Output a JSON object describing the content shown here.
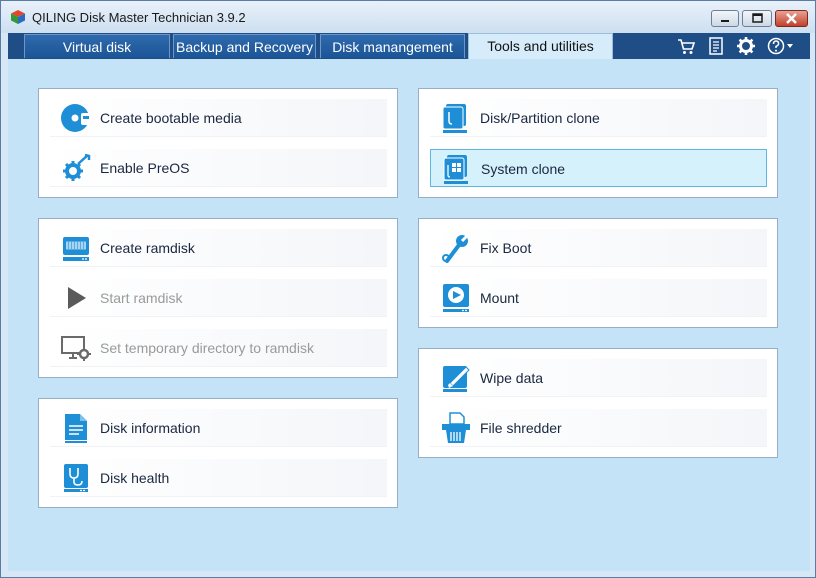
{
  "window": {
    "title": "QILING Disk Master Technician 3.9.2"
  },
  "tabs": [
    {
      "label": "Virtual disk"
    },
    {
      "label": "Backup and Recovery"
    },
    {
      "label": "Disk manangement"
    },
    {
      "label": "Tools and utilities",
      "active": true
    }
  ],
  "toolbar_icons": [
    "cart-icon",
    "list-icon",
    "gear-icon",
    "help-icon"
  ],
  "panels": {
    "boot": [
      {
        "label": "Create bootable media",
        "icon": "bootable-media-icon"
      },
      {
        "label": "Enable PreOS",
        "icon": "preos-icon"
      }
    ],
    "ramdisk": [
      {
        "label": "Create ramdisk",
        "icon": "ramdisk-icon"
      },
      {
        "label": "Start ramdisk",
        "icon": "play-icon",
        "disabled": true
      },
      {
        "label": "Set temporary directory to ramdisk",
        "icon": "monitor-gear-icon",
        "disabled": true
      }
    ],
    "diskinfo": [
      {
        "label": "Disk information",
        "icon": "disk-information-icon"
      },
      {
        "label": "Disk health",
        "icon": "disk-health-icon"
      }
    ],
    "clone": [
      {
        "label": "Disk/Partition clone",
        "icon": "disk-clone-icon"
      },
      {
        "label": "System clone",
        "icon": "system-clone-icon",
        "selected": true
      }
    ],
    "repair": [
      {
        "label": "Fix Boot",
        "icon": "wrench-icon"
      },
      {
        "label": "Mount",
        "icon": "mount-icon"
      }
    ],
    "wipe": [
      {
        "label": "Wipe data",
        "icon": "wipe-icon"
      },
      {
        "label": "File shredder",
        "icon": "shredder-icon"
      }
    ]
  },
  "colors": {
    "accent": "#1e8fd6",
    "tabbar": "#1e4e85",
    "content_bg": "#c4e3f6"
  }
}
